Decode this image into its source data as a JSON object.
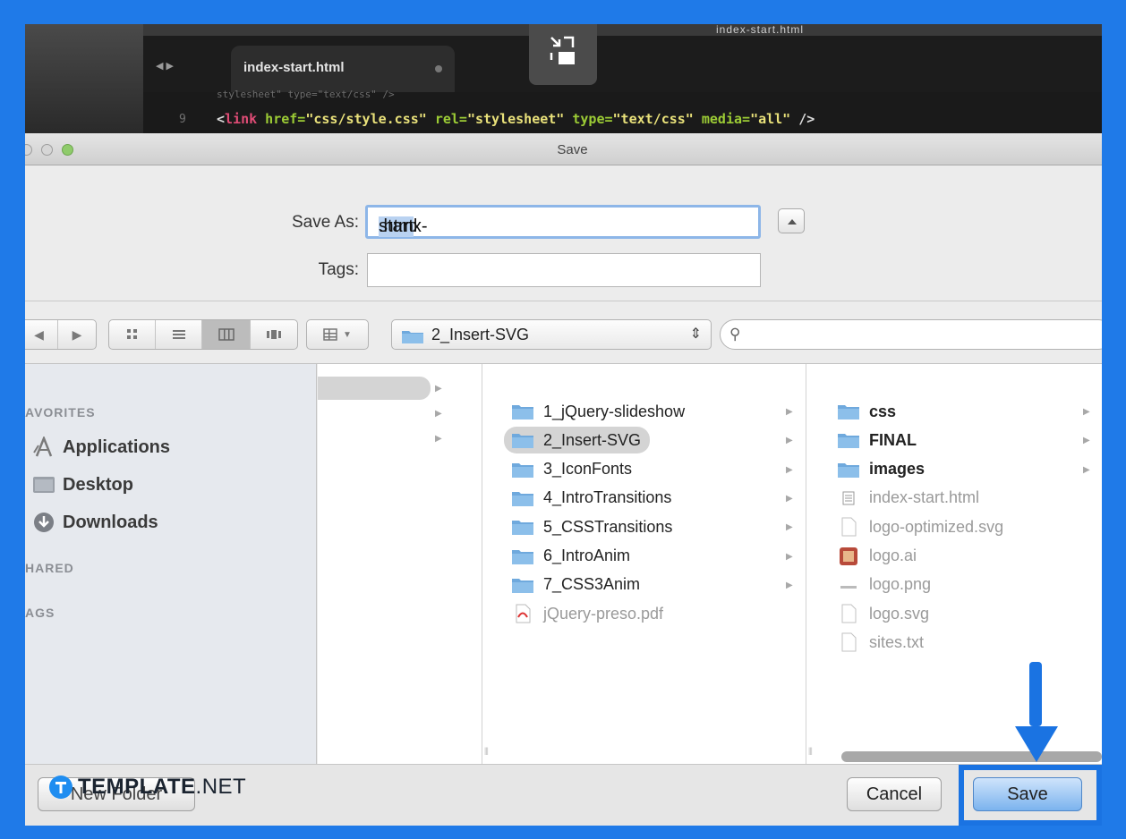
{
  "editor": {
    "window_title": "index-start.html",
    "tab_label": "index-start.html",
    "line_number": "9",
    "code_ghost": "stylesheet\" type=\"text/css\" />",
    "code": {
      "open": "<",
      "tag": "link",
      "attr1": " href=",
      "val1": "\"css/style.css\"",
      "attr2": " rel=",
      "val2": "\"stylesheet\"",
      "attr3": " type=",
      "val3": "\"text/css\"",
      "attr4": " media=",
      "val4": "\"all\"",
      "close": " />"
    }
  },
  "dialog": {
    "title": "Save",
    "save_as_label": "Save As:",
    "save_as_value_pre": "index-",
    "save_as_value_sel": "start",
    "save_as_value_post": ".html",
    "tags_label": "Tags:",
    "tags_value": ""
  },
  "toolbar": {
    "path_label": "2_Insert-SVG",
    "search_placeholder": ""
  },
  "sidebar": {
    "favorites_heading": "AVORITES",
    "favorites": [
      {
        "label": "Applications",
        "icon": "applications-icon"
      },
      {
        "label": "Desktop",
        "icon": "desktop-folder-icon"
      },
      {
        "label": "Downloads",
        "icon": "downloads-icon"
      }
    ],
    "shared_heading": "HARED",
    "tags_heading": "AGS"
  },
  "browser": {
    "column2": [
      {
        "label": "1_jQuery-slideshow",
        "type": "folder"
      },
      {
        "label": "2_Insert-SVG",
        "type": "folder",
        "selected": true
      },
      {
        "label": "3_IconFonts",
        "type": "folder"
      },
      {
        "label": "4_IntroTransitions",
        "type": "folder"
      },
      {
        "label": "5_CSSTransitions",
        "type": "folder"
      },
      {
        "label": "6_IntroAnim",
        "type": "folder"
      },
      {
        "label": "7_CSS3Anim",
        "type": "folder"
      },
      {
        "label": "jQuery-preso.pdf",
        "type": "pdf"
      }
    ],
    "column3": [
      {
        "label": "css",
        "type": "folder"
      },
      {
        "label": "FINAL",
        "type": "folder"
      },
      {
        "label": "images",
        "type": "folder"
      },
      {
        "label": "index-start.html",
        "type": "html"
      },
      {
        "label": "logo-optimized.svg",
        "type": "file"
      },
      {
        "label": "logo.ai",
        "type": "ai"
      },
      {
        "label": "logo.png",
        "type": "png"
      },
      {
        "label": "logo.svg",
        "type": "file"
      },
      {
        "label": "sites.txt",
        "type": "file"
      }
    ]
  },
  "buttons": {
    "new_folder": "New Folder",
    "cancel": "Cancel",
    "save": "Save"
  },
  "watermark": {
    "brand": "TEMPLATE",
    "suffix": ".NET"
  },
  "colors": {
    "frame_border": "#1f7ae8",
    "annotation": "#1a73e2",
    "folder": "#6fa9dd"
  }
}
